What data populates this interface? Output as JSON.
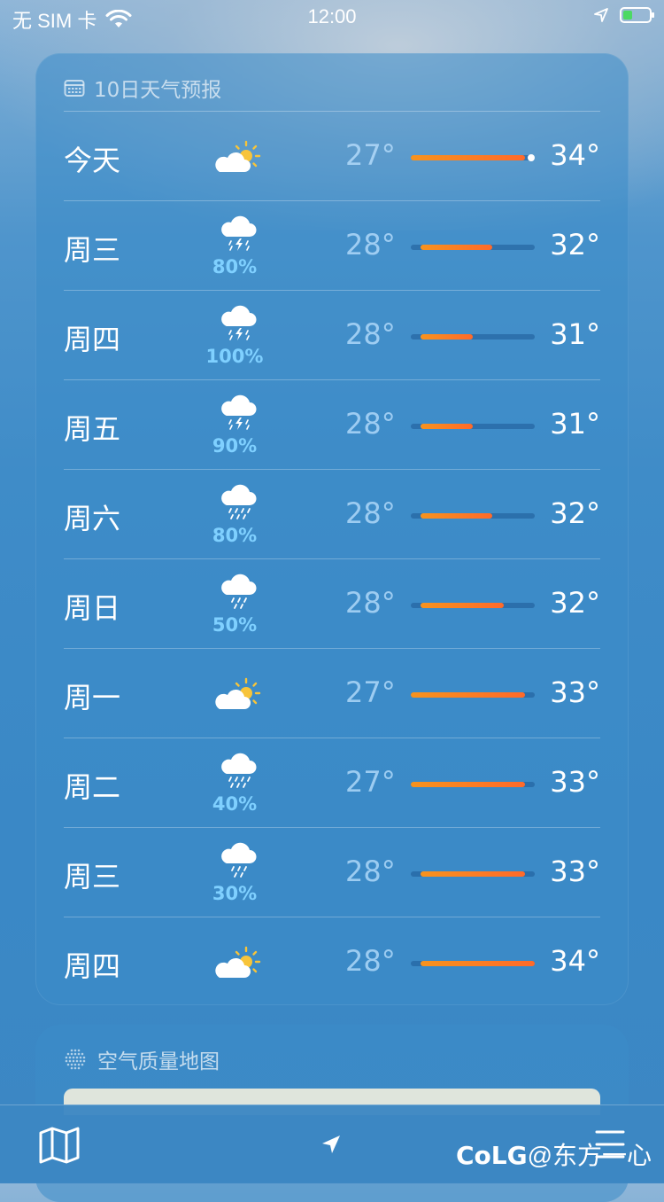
{
  "status_bar": {
    "carrier": "无 SIM 卡",
    "time": "12:00",
    "battery_level": 0.35
  },
  "forecast": {
    "title": "10日天气预报",
    "rows": [
      {
        "day": "今天",
        "icon": "partly-sunny-icon",
        "precip": "",
        "low": "27°",
        "high": "34°",
        "bar_start": 0.0,
        "bar_end": 0.92,
        "current_dot": 0.97
      },
      {
        "day": "周三",
        "icon": "thunderstorm-icon",
        "precip": "80%",
        "low": "28°",
        "high": "32°",
        "bar_start": 0.08,
        "bar_end": 0.66
      },
      {
        "day": "周四",
        "icon": "thunderstorm-icon",
        "precip": "100%",
        "low": "28°",
        "high": "31°",
        "bar_start": 0.08,
        "bar_end": 0.5
      },
      {
        "day": "周五",
        "icon": "thunderstorm-icon",
        "precip": "90%",
        "low": "28°",
        "high": "31°",
        "bar_start": 0.08,
        "bar_end": 0.5
      },
      {
        "day": "周六",
        "icon": "rain-icon",
        "precip": "80%",
        "low": "28°",
        "high": "32°",
        "bar_start": 0.08,
        "bar_end": 0.66
      },
      {
        "day": "周日",
        "icon": "light-rain-icon",
        "precip": "50%",
        "low": "28°",
        "high": "32°",
        "bar_start": 0.08,
        "bar_end": 0.75
      },
      {
        "day": "周一",
        "icon": "partly-sunny-icon",
        "precip": "",
        "low": "27°",
        "high": "33°",
        "bar_start": 0.0,
        "bar_end": 0.92
      },
      {
        "day": "周二",
        "icon": "rain-icon",
        "precip": "40%",
        "low": "27°",
        "high": "33°",
        "bar_start": 0.0,
        "bar_end": 0.92
      },
      {
        "day": "周三",
        "icon": "light-rain-icon",
        "precip": "30%",
        "low": "28°",
        "high": "33°",
        "bar_start": 0.08,
        "bar_end": 0.92
      },
      {
        "day": "周四",
        "icon": "partly-sunny-icon",
        "precip": "",
        "low": "28°",
        "high": "34°",
        "bar_start": 0.08,
        "bar_end": 1.0
      }
    ]
  },
  "air_quality": {
    "title": "空气质量地图"
  },
  "watermark": {
    "brand": "CoLG",
    "handle": "@东方一心"
  },
  "colors": {
    "bar_start": "#f7931e",
    "bar_end": "#ff6a2a",
    "precip_text": "#7fd0ff"
  }
}
